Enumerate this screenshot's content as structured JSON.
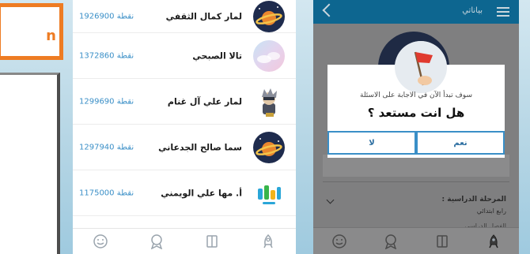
{
  "left_panel": {
    "partial_label": "n"
  },
  "leaderboard": {
    "rows": [
      {
        "name": "لمار كمال الثقفي",
        "score": "نقطة 1926900",
        "avatar": "planet-icon"
      },
      {
        "name": "تالا الصبحي",
        "score": "نقطة 1372860",
        "avatar": "cloud-avatar"
      },
      {
        "name": "لمار علي آل غنام",
        "score": "نقطة 1299690",
        "avatar": "character-avatar"
      },
      {
        "name": "سما صالح الجدعاني",
        "score": "نقطة 1297940",
        "avatar": "planet-icon"
      },
      {
        "name": "أ. مها علي الويمني",
        "score": "نقطة 1175000",
        "avatar": "logo-avatar"
      }
    ],
    "nav": [
      "smile-icon",
      "award-icon",
      "book-icon",
      "rocket-icon"
    ]
  },
  "profile": {
    "title": "بياناتي",
    "field_label": "المرحلة الدراسية :",
    "field_value": "رابع ابتدائي",
    "field_ghost": "الفصل الدراسي",
    "dialog": {
      "message": "سوف تبدأ الآن في الاجابة على الاسئلة",
      "question": "هل انت مستعد ؟",
      "yes_label": "نعم",
      "no_label": "لا"
    }
  },
  "colors": {
    "accent_orange": "#ee7c23",
    "score_blue": "#3a8fc7",
    "topbar_blue": "#0d6690",
    "overlay_gray": "#7f7f80"
  }
}
